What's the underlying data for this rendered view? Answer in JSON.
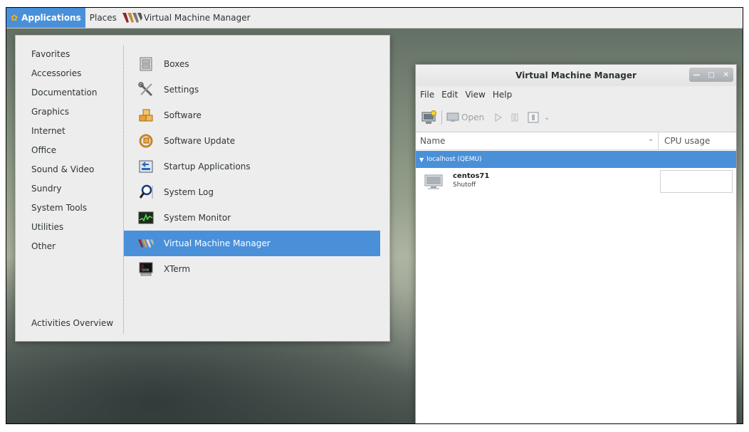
{
  "topbar": {
    "applications": "Applications",
    "places": "Places",
    "active_window": "Virtual Machine Manager"
  },
  "app_menu": {
    "categories": [
      "Favorites",
      "Accessories",
      "Documentation",
      "Graphics",
      "Internet",
      "Office",
      "Sound & Video",
      "Sundry",
      "System Tools",
      "Utilities",
      "Other"
    ],
    "activities": "Activities Overview",
    "apps": [
      {
        "label": "Boxes",
        "icon": "boxes-icon"
      },
      {
        "label": "Settings",
        "icon": "settings-tools-icon"
      },
      {
        "label": "Software",
        "icon": "software-package-icon"
      },
      {
        "label": "Software Update",
        "icon": "software-update-icon"
      },
      {
        "label": "Startup Applications",
        "icon": "startup-applications-icon"
      },
      {
        "label": "System Log",
        "icon": "system-log-magnifier-icon"
      },
      {
        "label": "System Monitor",
        "icon": "system-monitor-icon"
      },
      {
        "label": "Virtual Machine Manager",
        "icon": "virt-manager-icon",
        "selected": true
      },
      {
        "label": "XTerm",
        "icon": "xterm-icon"
      }
    ],
    "selected_color": "#4a90d9"
  },
  "vmm": {
    "title": "Virtual Machine Manager",
    "menu": [
      "File",
      "Edit",
      "View",
      "Help"
    ],
    "toolbar": {
      "open_label": "Open"
    },
    "columns": {
      "name": "Name",
      "cpu": "CPU usage"
    },
    "group": "localhost (QEMU)",
    "vm": {
      "name": "centos71",
      "status": "Shutoff"
    }
  }
}
